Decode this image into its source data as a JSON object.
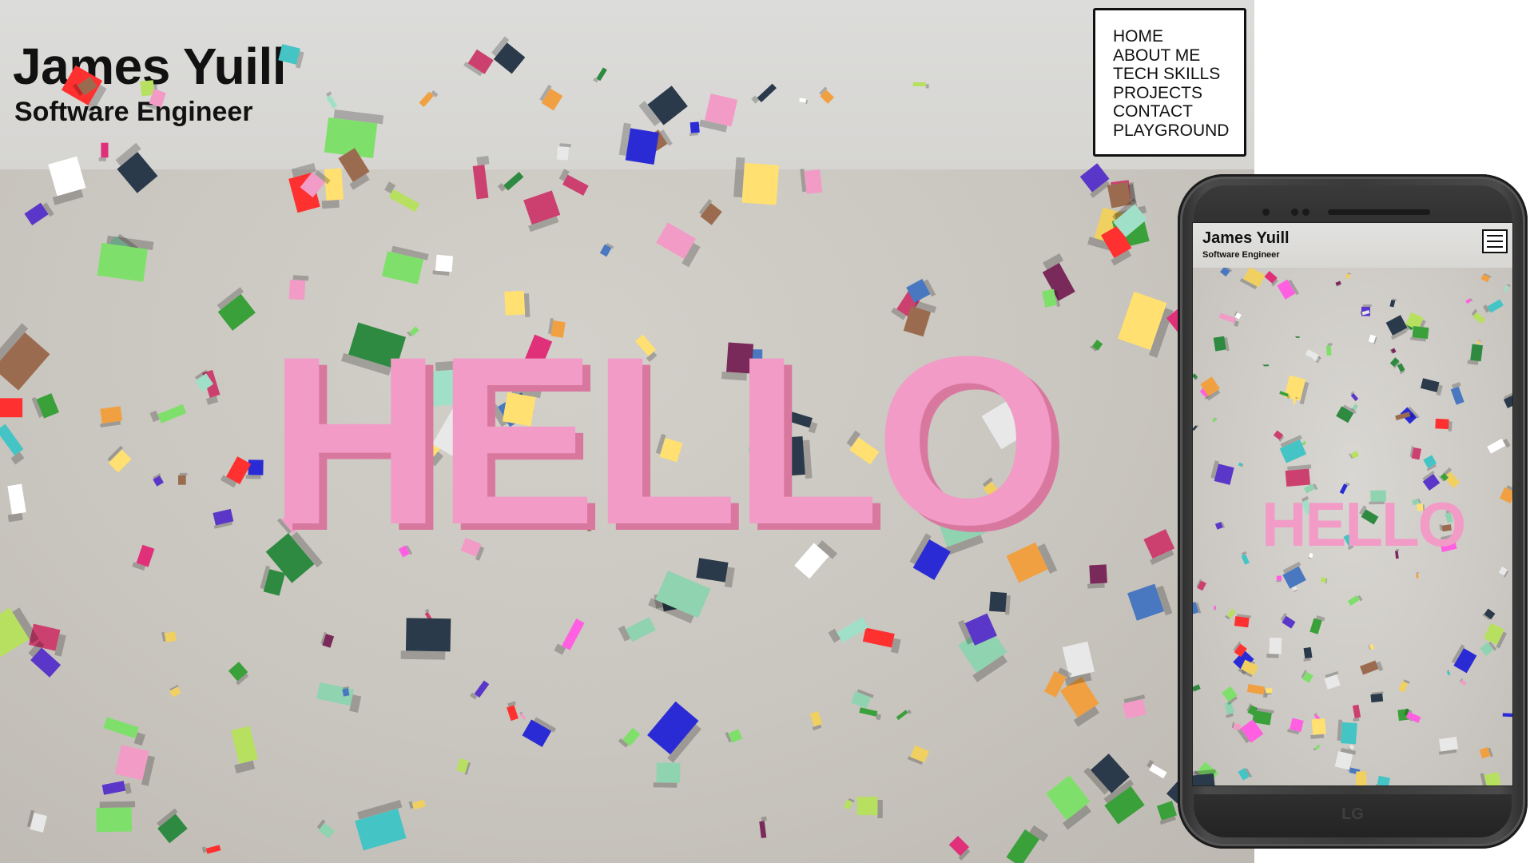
{
  "desktop": {
    "header": {
      "name": "James Yuill",
      "role": "Software Engineer"
    },
    "nav": {
      "items": [
        "HOME",
        "ABOUT ME",
        "TECH SKILLS",
        "PROJECTS",
        "CONTACT",
        "PLAYGROUND"
      ]
    },
    "hero_text": "HELLO"
  },
  "mobile": {
    "header": {
      "name": "James Yuill",
      "role": "Software Engineer"
    },
    "menu_icon": "hamburger-menu-icon",
    "hero_text": "HELLO",
    "brand": "LG"
  },
  "colors": {
    "hello_pink": "#f29bc6",
    "background": "#cac6c0",
    "phone_body": "#333333"
  }
}
